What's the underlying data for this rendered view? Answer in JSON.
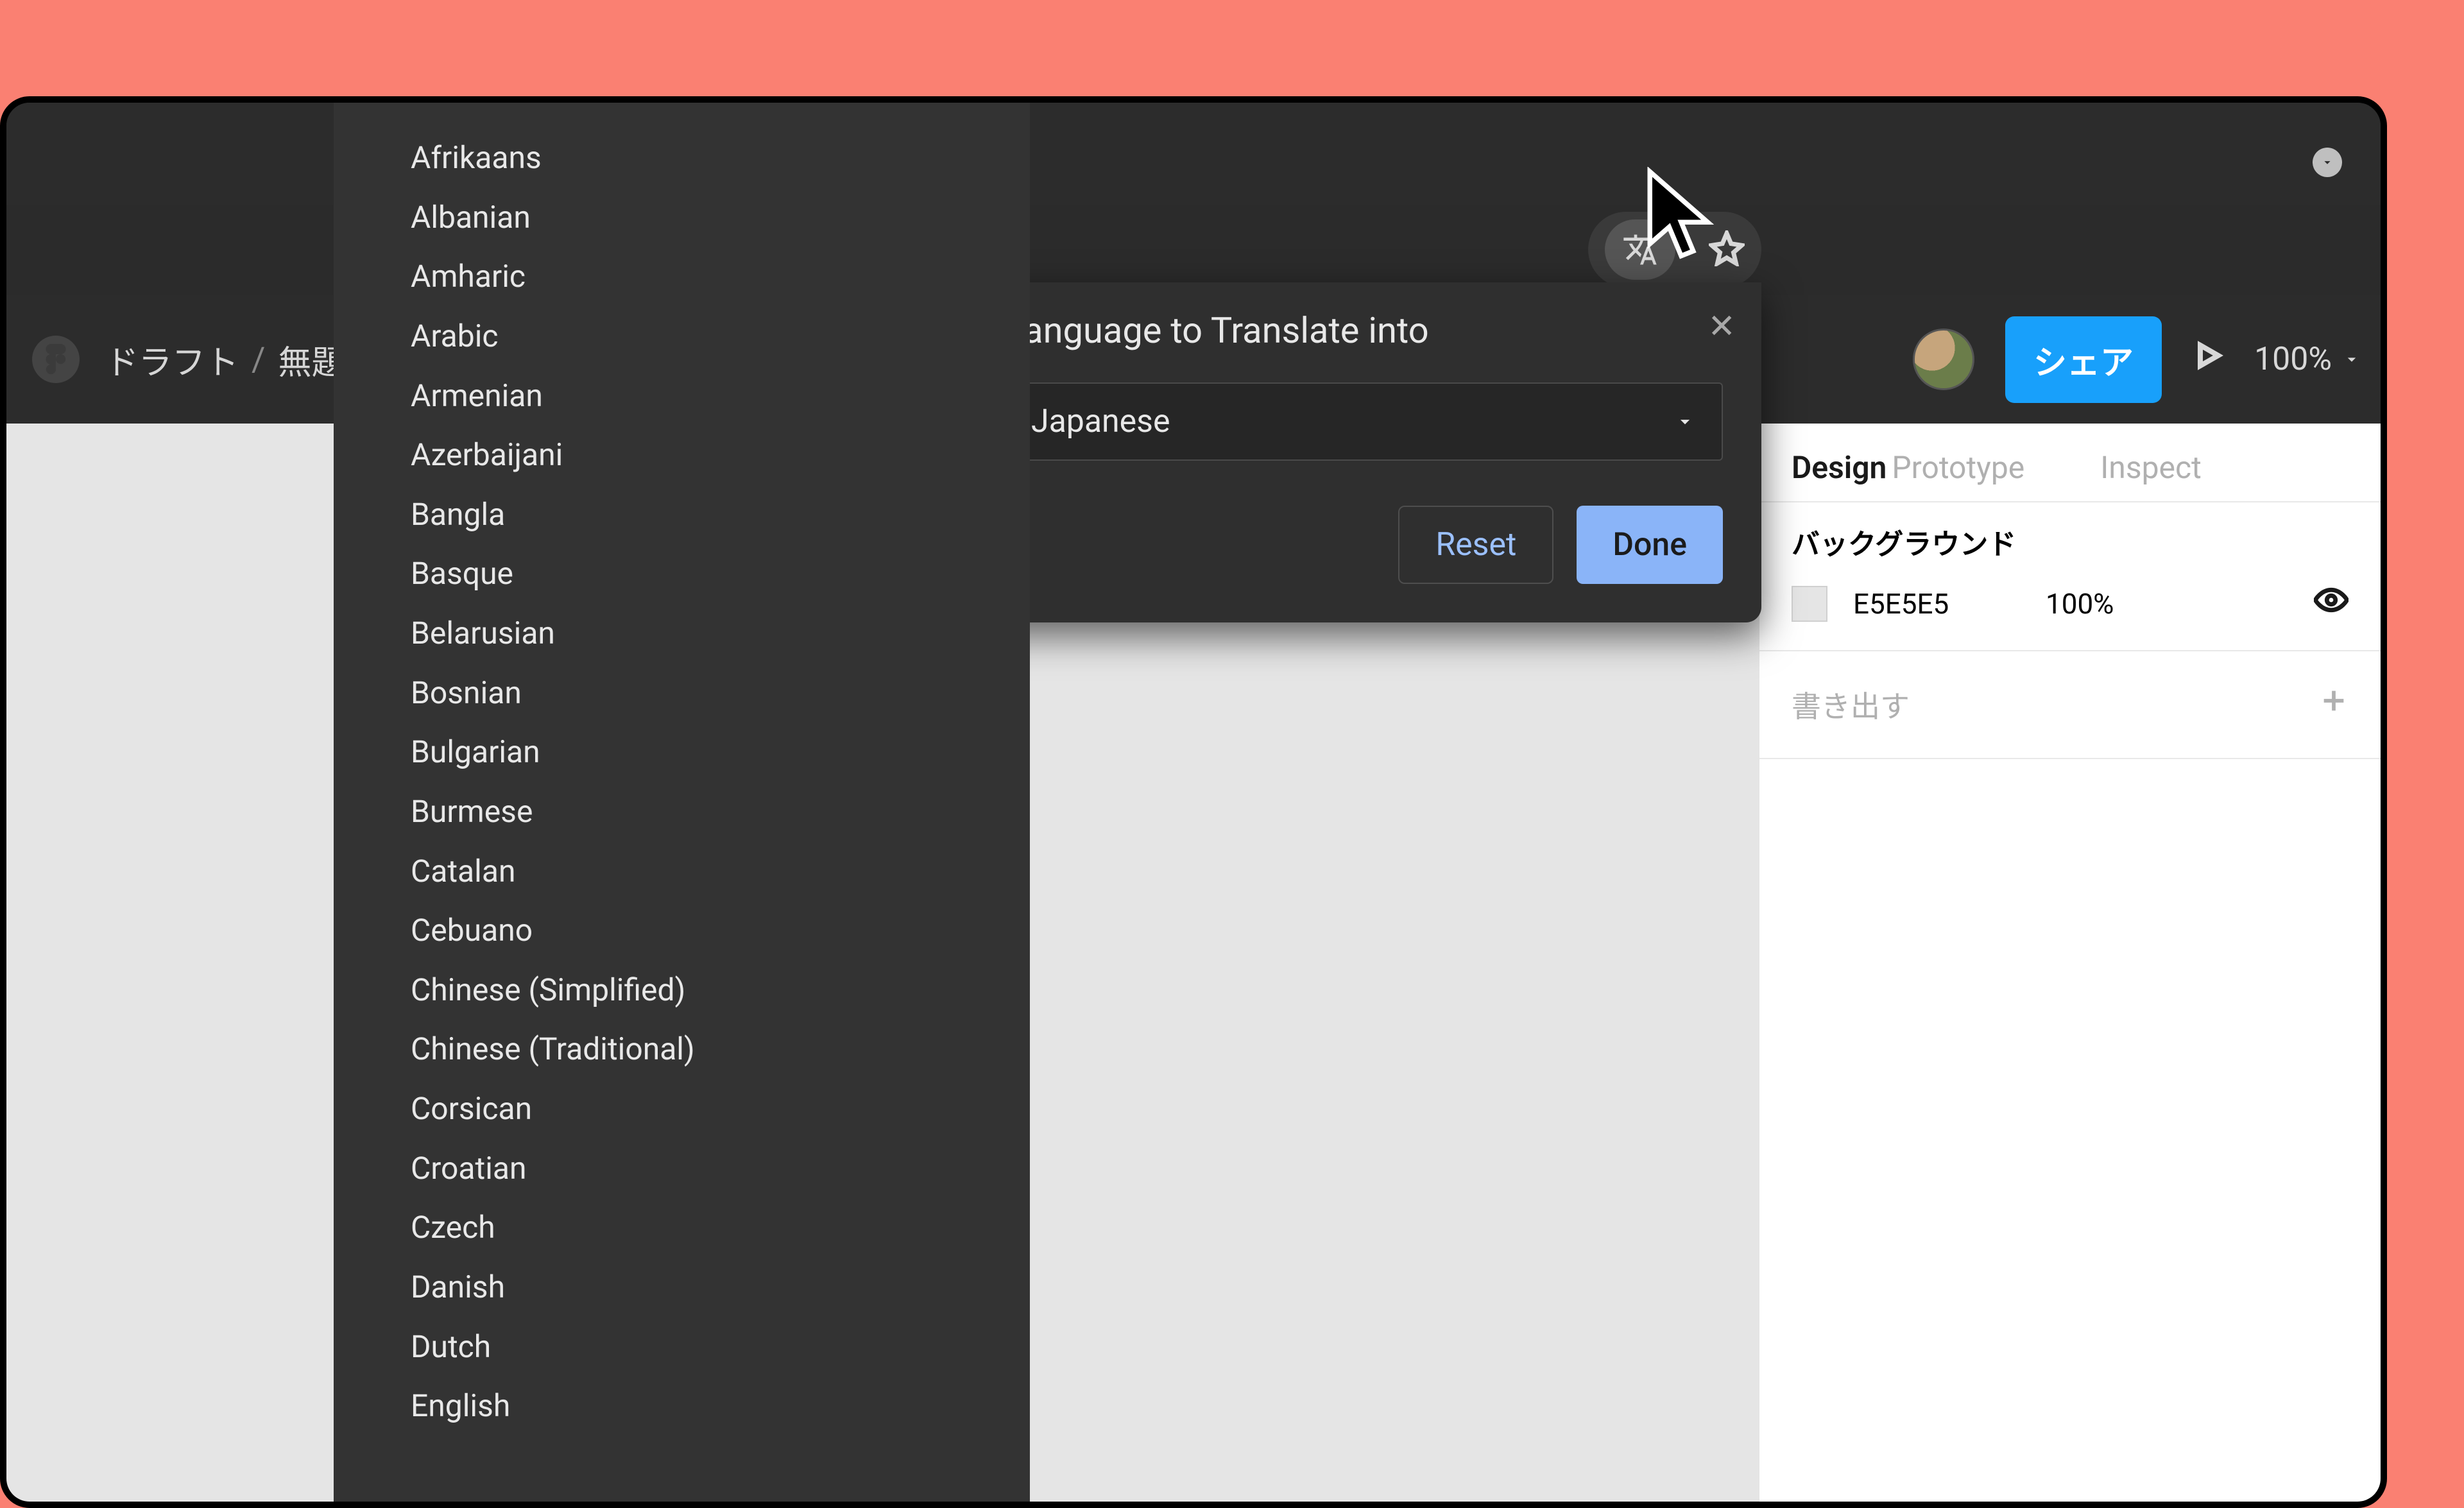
{
  "chrome": {},
  "figma": {
    "crumb_drafts": "ドラフト",
    "crumb_untitled": "無題",
    "share_label": "シェア",
    "zoom": "100%"
  },
  "tabs": {
    "design": "Design",
    "prototype": "Prototype",
    "inspect": "Inspect"
  },
  "bg": {
    "label": "バックグラウンド",
    "hex": "E5E5E5",
    "opacity": "100%"
  },
  "exportSection": {
    "label": "書き出す"
  },
  "dialog": {
    "title": "Language to Translate into",
    "selected": "Japanese",
    "reset": "Reset",
    "done": "Done"
  },
  "languages": [
    "Afrikaans",
    "Albanian",
    "Amharic",
    "Arabic",
    "Armenian",
    "Azerbaijani",
    "Bangla",
    "Basque",
    "Belarusian",
    "Bosnian",
    "Bulgarian",
    "Burmese",
    "Catalan",
    "Cebuano",
    "Chinese (Simplified)",
    "Chinese (Traditional)",
    "Corsican",
    "Croatian",
    "Czech",
    "Danish",
    "Dutch",
    "English"
  ]
}
